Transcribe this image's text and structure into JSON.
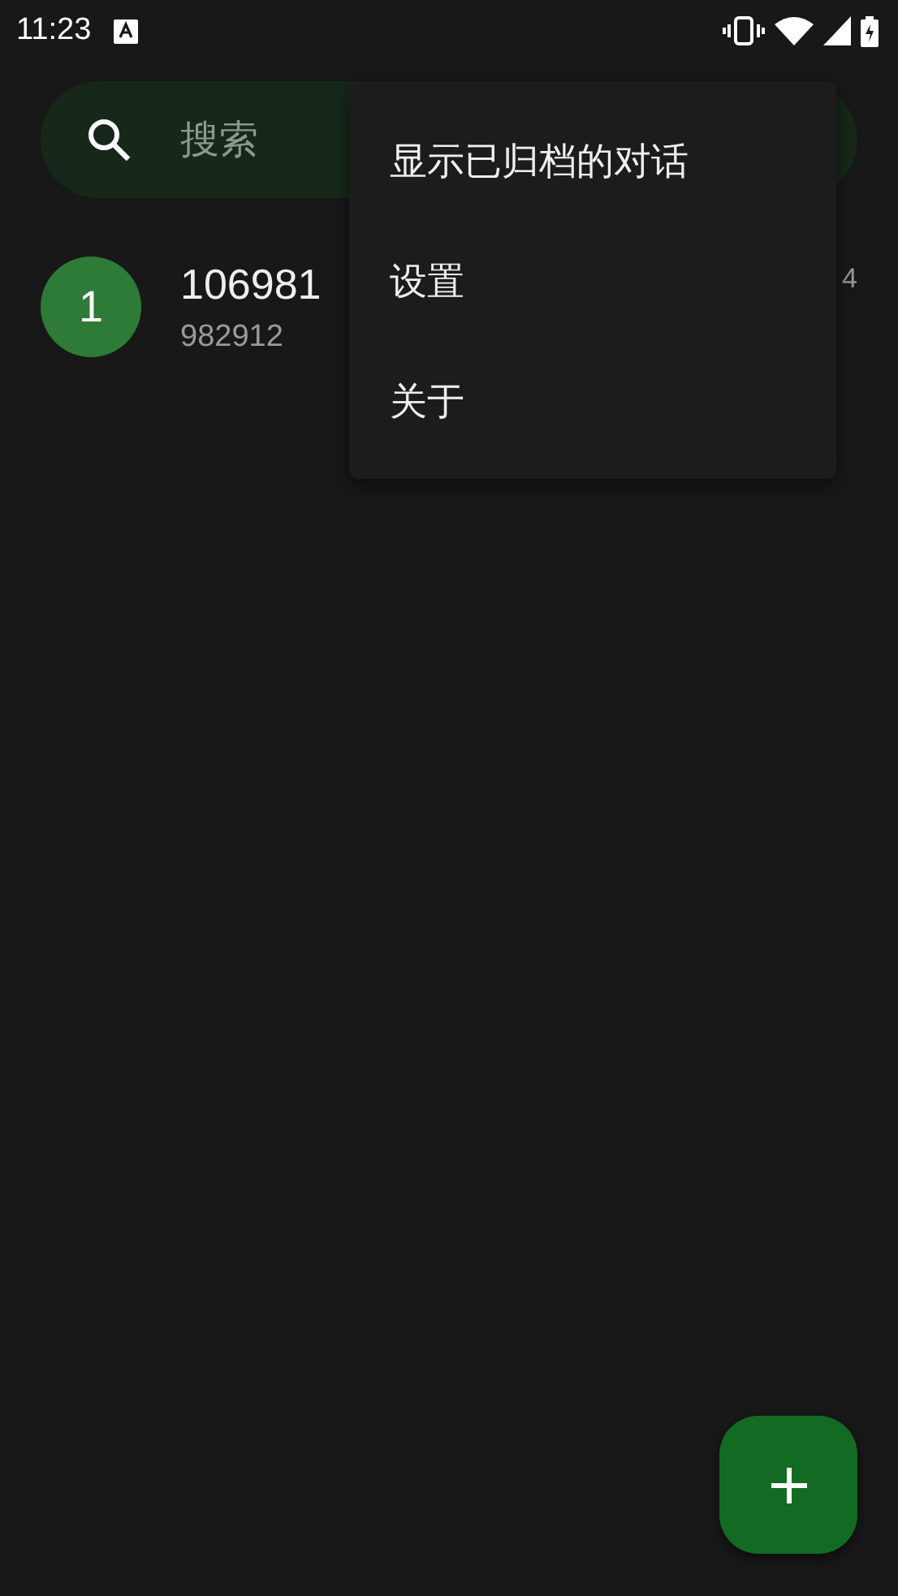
{
  "status_bar": {
    "time": "11:23"
  },
  "search": {
    "placeholder": "搜索"
  },
  "conversations": [
    {
      "avatar": "1",
      "title": "106981",
      "snippet": "982912",
      "time": "4"
    }
  ],
  "menu": {
    "items": [
      {
        "label": "显示已归档的对话"
      },
      {
        "label": "设置"
      },
      {
        "label": "关于"
      }
    ]
  }
}
